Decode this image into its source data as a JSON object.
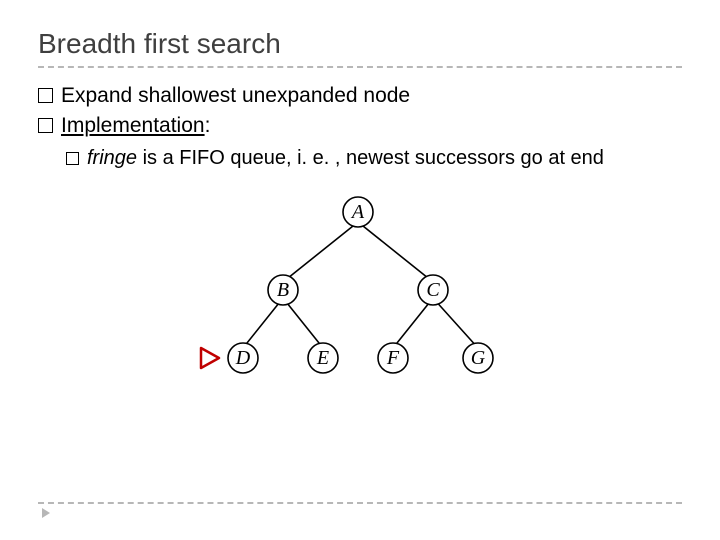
{
  "slide": {
    "title": "Breadth first search",
    "bullets": {
      "b1_prefix": "Expand ",
      "b1_rest": "shallowest unexpanded node",
      "b2_label": "Implementation",
      "b2_colon": ":",
      "b3_word": "fringe",
      "b3_rest": " is a FIFO queue, i. e. , newest successors go at end"
    }
  },
  "tree": {
    "nodes": {
      "A": "A",
      "B": "B",
      "C": "C",
      "D": "D",
      "E": "E",
      "F": "F",
      "G": "G"
    }
  }
}
